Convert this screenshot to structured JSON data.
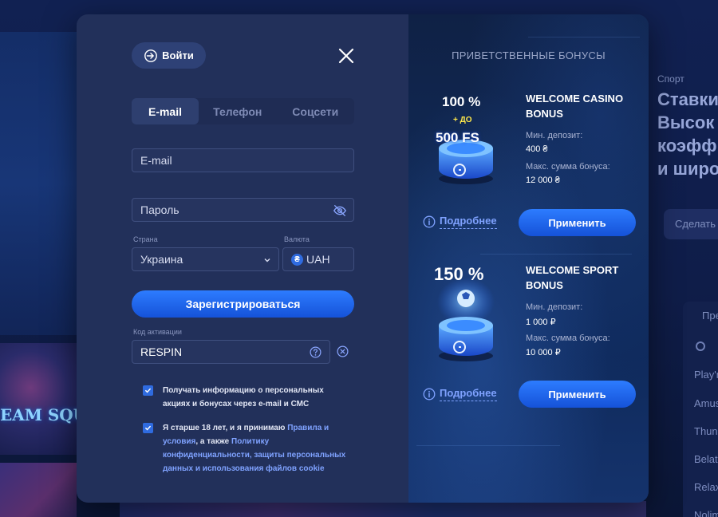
{
  "background": {
    "sport_label": "Спорт",
    "headline": "Ставки\nВысок\nкоэфф\nи широ",
    "cta_label": "Сделать",
    "panel_title": "Пре",
    "providers": [
      "Play'n",
      "Amus",
      "Thun",
      "Belat",
      "Relax",
      "Nolim"
    ],
    "game_title": "EAM SQU"
  },
  "modal": {
    "login_label": "Войти",
    "tabs": [
      {
        "label": "E-mail",
        "active": true
      },
      {
        "label": "Телефон",
        "active": false
      },
      {
        "label": "Соцсети",
        "active": false
      }
    ],
    "email_placeholder": "E-mail",
    "password_placeholder": "Пароль",
    "country_label": "Страна",
    "country_value": "Украина",
    "currency_label": "Валюта",
    "currency_symbol": "₴",
    "currency_value": "UAH",
    "register_label": "Зарегистрироваться",
    "promo_label": "Код активации",
    "promo_value": "RESPIN",
    "consent_marketing": "Получать информацию о персональных акциях и бонусах через e-mail и СМС",
    "consent_age_prefix": "Я старше 18 лет, и я принимаю ",
    "consent_age_link1": "Правила и условия",
    "consent_age_mid": ", а также ",
    "consent_age_link2": "Политику конфиденциальности, защиты персональных данных и использования файлов cookie"
  },
  "bonuses": {
    "title": "ПРИВЕТСТВЕННЫЕ БОНУСЫ",
    "items": [
      {
        "art_percent": "100 %",
        "art_plus": "+ ДО",
        "art_fs": "500 FS",
        "name_line1": "WELCOME CASINO",
        "name_line2": "BONUS",
        "min_deposit_label": "Мин. депозит:",
        "min_deposit_value": "400 ₴",
        "max_bonus_label": "Макс. сумма бонуса:",
        "max_bonus_value": "12 000 ₴",
        "details_label": "Подробнее",
        "apply_label": "Применить"
      },
      {
        "art_percent": "150 %",
        "name_line1": "WELCOME SPORT",
        "name_line2": "BONUS",
        "min_deposit_label": "Мин. депозит:",
        "min_deposit_value": "1 000 ₽",
        "max_bonus_label": "Макс. сумма бонуса:",
        "max_bonus_value": "10 000 ₽",
        "details_label": "Подробнее",
        "apply_label": "Применить"
      }
    ]
  },
  "colors": {
    "accent": "#2d7cff",
    "link": "#7fa2ff",
    "form_bg": "#22305a"
  }
}
